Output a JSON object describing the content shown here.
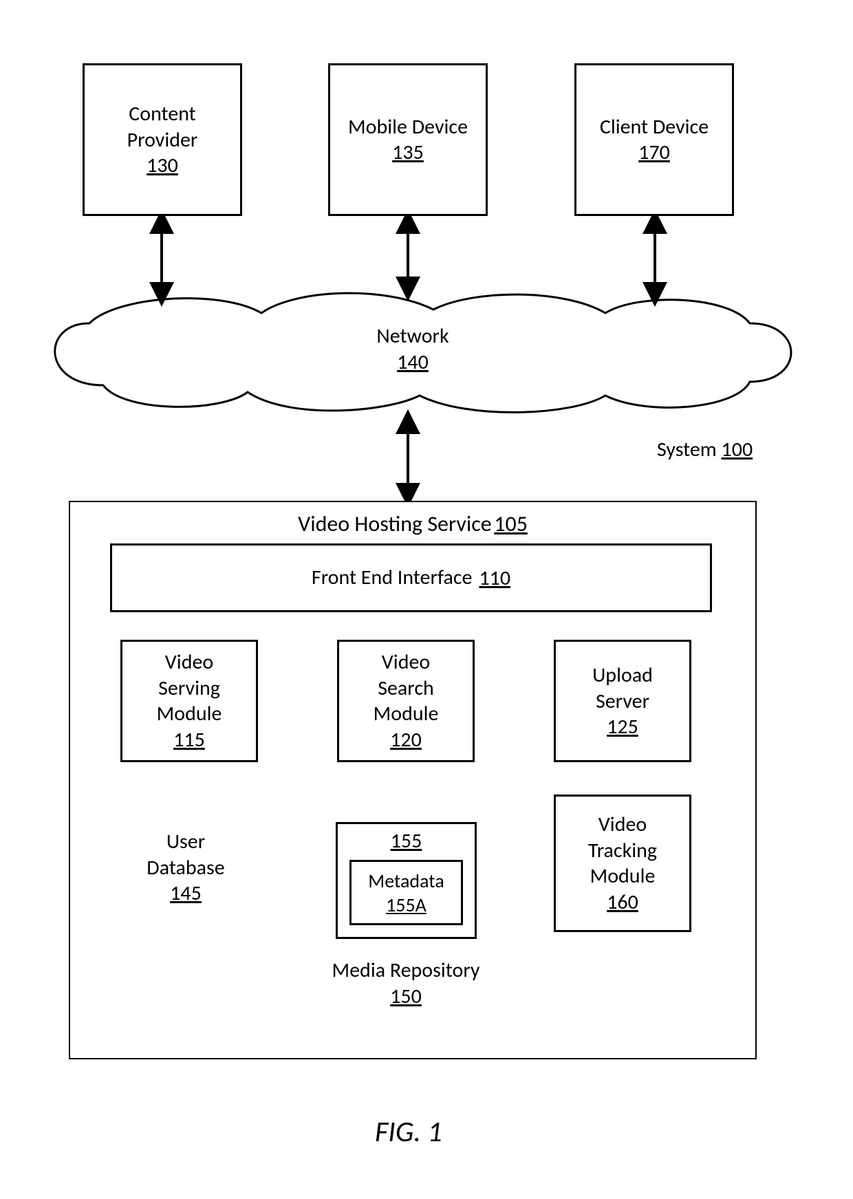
{
  "system": {
    "label": "System",
    "ref": "100"
  },
  "top": {
    "contentProvider": {
      "label": "Content\nProvider",
      "ref": "130"
    },
    "mobileDevice": {
      "label": "Mobile Device",
      "ref": "135"
    },
    "clientDevice": {
      "label": "Client Device",
      "ref": "170"
    }
  },
  "network": {
    "label": "Network",
    "ref": "140"
  },
  "host": {
    "title": "Video Hosting Service",
    "ref": "105",
    "frontEnd": {
      "label": "Front End Interface",
      "ref": "110"
    },
    "videoServing": {
      "label": "Video\nServing\nModule",
      "ref": "115"
    },
    "videoSearch": {
      "label": "Video\nSearch\nModule",
      "ref": "120"
    },
    "uploadServer": {
      "label": "Upload\nServer",
      "ref": "125"
    },
    "userDb": {
      "label": "User\nDatabase",
      "ref": "145"
    },
    "mediaRepo": {
      "label": "Media Repository",
      "ref": "150",
      "innerOuterRef": "155",
      "metadata": {
        "label": "Metadata",
        "ref": "155A"
      }
    },
    "videoTracking": {
      "label": "Video\nTracking\nModule",
      "ref": "160"
    }
  },
  "figure": "FIG. 1"
}
